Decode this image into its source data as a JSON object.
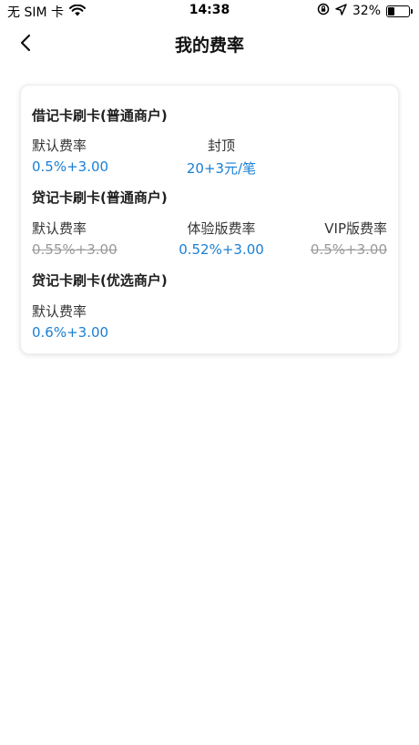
{
  "status_bar": {
    "carrier": "无 SIM 卡",
    "wifi_icon": "wifi-icon",
    "time": "14:38",
    "lock_icon": "orientation-lock-icon",
    "location_icon": "location-arrow-icon",
    "battery_percent": "32%",
    "battery_level": 0.32
  },
  "nav": {
    "back_icon": "chevron-left-icon",
    "title": "我的费率"
  },
  "sections": [
    {
      "title": "借记卡刷卡(普通商户)",
      "columns": [
        {
          "label": "默认费率",
          "value": "0.5%+3.00",
          "strike": false
        },
        {
          "label": "封顶",
          "value": "20+3元/笔",
          "strike": false
        }
      ]
    },
    {
      "title": "贷记卡刷卡(普通商户)",
      "columns": [
        {
          "label": "默认费率",
          "value": "0.55%+3.00",
          "strike": true
        },
        {
          "label": "体验版费率",
          "value": "0.52%+3.00",
          "strike": false
        },
        {
          "label": "VIP版费率",
          "value": "0.5%+3.00",
          "strike": true
        }
      ]
    },
    {
      "title": "贷记卡刷卡(优选商户)",
      "columns": [
        {
          "label": "默认费率",
          "value": "0.6%+3.00",
          "strike": false
        }
      ]
    }
  ],
  "colors": {
    "accent": "#1a7fd4",
    "strike": "#9a9a9a",
    "text": "#1f1f1f"
  }
}
